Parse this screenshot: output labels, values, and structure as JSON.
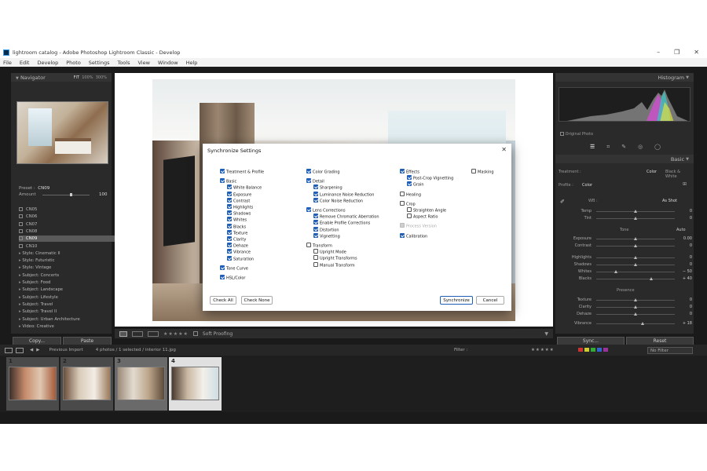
{
  "window": {
    "title": "lightroom catalog - Adobe Photoshop Lightroom Classic - Develop",
    "minimize": "–",
    "maximize": "❐",
    "close": "✕"
  },
  "menu": [
    "File",
    "Edit",
    "Develop",
    "Photo",
    "Settings",
    "Tools",
    "View",
    "Window",
    "Help"
  ],
  "navigator": {
    "title": "Navigator",
    "zoom_options": [
      "FIT",
      "100%",
      "300%"
    ],
    "preset_label": "Preset",
    "preset_value": "CN09",
    "amount_label": "Amount",
    "amount_value": "100",
    "amount_level": 0.6
  },
  "collections": [
    {
      "label": "CN05",
      "selected": false
    },
    {
      "label": "CN06",
      "selected": false
    },
    {
      "label": "CN07",
      "selected": false
    },
    {
      "label": "CN08",
      "selected": false
    },
    {
      "label": "CN09",
      "selected": true
    },
    {
      "label": "CN10",
      "selected": false
    },
    {
      "label": "Style: Cinematic II",
      "selected": false
    },
    {
      "label": "Style: Futuristic",
      "selected": false
    },
    {
      "label": "Style: Vintage",
      "selected": false
    },
    {
      "label": "Subject: Concerts",
      "selected": false
    },
    {
      "label": "Subject: Food",
      "selected": false
    },
    {
      "label": "Subject: Landscape",
      "selected": false
    },
    {
      "label": "Subject: Lifestyle",
      "selected": false
    },
    {
      "label": "Subject: Travel",
      "selected": false
    },
    {
      "label": "Subject: Travel II",
      "selected": false
    },
    {
      "label": "Subject: Urban Architecture",
      "selected": false
    },
    {
      "label": "Video: Creative",
      "selected": false
    }
  ],
  "left_buttons": {
    "copy": "Copy...",
    "paste": "Paste"
  },
  "toolbar": {
    "stars": "★★★★★",
    "soft_proofing": "Soft Proofing"
  },
  "histogram": {
    "title": "Histogram",
    "original_photo": "Original Photo"
  },
  "basic": {
    "title": "Basic",
    "treatment_label": "Treatment :",
    "treatment_color": "Color",
    "treatment_bw": "Black & White",
    "profile_label": "Profile :",
    "profile_value": "Color",
    "wb_label": "WB :",
    "wb_value": "As Shot",
    "tone_label": "Tone",
    "auto_label": "Auto",
    "presence_label": "Presence",
    "sliders": [
      {
        "label": "Temp",
        "value": "0",
        "pos": 0.5
      },
      {
        "label": "Tint",
        "value": "0",
        "pos": 0.5
      },
      {
        "label": "Exposure",
        "value": "0.00",
        "pos": 0.5
      },
      {
        "label": "Contrast",
        "value": "0",
        "pos": 0.5
      },
      {
        "label": "Highlights",
        "value": "0",
        "pos": 0.5
      },
      {
        "label": "Shadows",
        "value": "0",
        "pos": 0.5
      },
      {
        "label": "Whites",
        "value": "− 50",
        "pos": 0.25
      },
      {
        "label": "Blacks",
        "value": "+ 40",
        "pos": 0.7
      },
      {
        "label": "Texture",
        "value": "0",
        "pos": 0.5
      },
      {
        "label": "Clarity",
        "value": "0",
        "pos": 0.5
      },
      {
        "label": "Dehaze",
        "value": "0",
        "pos": 0.5
      },
      {
        "label": "Vibrance",
        "value": "+ 18",
        "pos": 0.59
      }
    ]
  },
  "right_buttons": {
    "sync": "Sync...",
    "reset": "Reset"
  },
  "filmbar": {
    "source": "Previous Import",
    "info": "4 photos / 1 selected / interior 11.jpg",
    "filter_label": "Filter :",
    "no_filter": "No Filter"
  },
  "filmstrip": [
    {
      "num": "1"
    },
    {
      "num": "2"
    },
    {
      "num": "3"
    },
    {
      "num": "4"
    }
  ],
  "dialog": {
    "title": "Synchronize Settings",
    "close": "✕",
    "check_all": "Check All",
    "check_none": "Check None",
    "synchronize": "Synchronize",
    "cancel": "Cancel",
    "col1": [
      {
        "label": "Treatment & Profile",
        "on": true,
        "indent": 0
      },
      {
        "label": "Basic",
        "on": true,
        "indent": 0
      },
      {
        "label": "White Balance",
        "on": true,
        "indent": 1
      },
      {
        "label": "Exposure",
        "on": true,
        "indent": 1
      },
      {
        "label": "Contrast",
        "on": true,
        "indent": 1
      },
      {
        "label": "Highlights",
        "on": true,
        "indent": 1
      },
      {
        "label": "Shadows",
        "on": true,
        "indent": 1
      },
      {
        "label": "Whites",
        "on": true,
        "indent": 1
      },
      {
        "label": "Blacks",
        "on": true,
        "indent": 1
      },
      {
        "label": "Texture",
        "on": true,
        "indent": 1
      },
      {
        "label": "Clarity",
        "on": true,
        "indent": 1
      },
      {
        "label": "Dehaze",
        "on": true,
        "indent": 1
      },
      {
        "label": "Vibrance",
        "on": true,
        "indent": 1
      },
      {
        "label": "Saturation",
        "on": true,
        "indent": 1
      },
      {
        "label": "Tone Curve",
        "on": true,
        "indent": 0
      },
      {
        "label": "HSL/Color",
        "on": true,
        "indent": 0
      }
    ],
    "col2": [
      {
        "label": "Color Grading",
        "on": true,
        "indent": 0
      },
      {
        "label": "Detail",
        "on": true,
        "indent": 0
      },
      {
        "label": "Sharpening",
        "on": true,
        "indent": 1
      },
      {
        "label": "Luminance Noise Reduction",
        "on": true,
        "indent": 1
      },
      {
        "label": "Color Noise Reduction",
        "on": true,
        "indent": 1
      },
      {
        "label": "Lens Corrections",
        "on": true,
        "indent": 0
      },
      {
        "label": "Remove Chromatic Aberration",
        "on": true,
        "indent": 1
      },
      {
        "label": "Enable Profile Corrections",
        "on": true,
        "indent": 1
      },
      {
        "label": "Distortion",
        "on": true,
        "indent": 1
      },
      {
        "label": "Vignetting",
        "on": true,
        "indent": 1
      },
      {
        "label": "Transform",
        "on": false,
        "indent": 0
      },
      {
        "label": "Upright Mode",
        "on": false,
        "indent": 1
      },
      {
        "label": "Upright Transforms",
        "on": false,
        "indent": 1
      },
      {
        "label": "Manual Transform",
        "on": false,
        "indent": 1
      }
    ],
    "col3": [
      {
        "label": "Effects",
        "on": true,
        "indent": 0
      },
      {
        "label": "Post-Crop Vignetting",
        "on": true,
        "indent": 1
      },
      {
        "label": "Grain",
        "on": true,
        "indent": 1
      },
      {
        "label": "Healing",
        "on": false,
        "indent": 0
      },
      {
        "label": "Crop",
        "on": false,
        "indent": 0
      },
      {
        "label": "Straighten Angle",
        "on": false,
        "indent": 1
      },
      {
        "label": "Aspect Ratio",
        "on": false,
        "indent": 1
      },
      {
        "label": "Process Version",
        "on": false,
        "indent": 0,
        "disabled": true
      },
      {
        "label": "Calibration",
        "on": true,
        "indent": 0
      }
    ],
    "col4": [
      {
        "label": "Masking",
        "on": false,
        "indent": 0
      }
    ]
  }
}
